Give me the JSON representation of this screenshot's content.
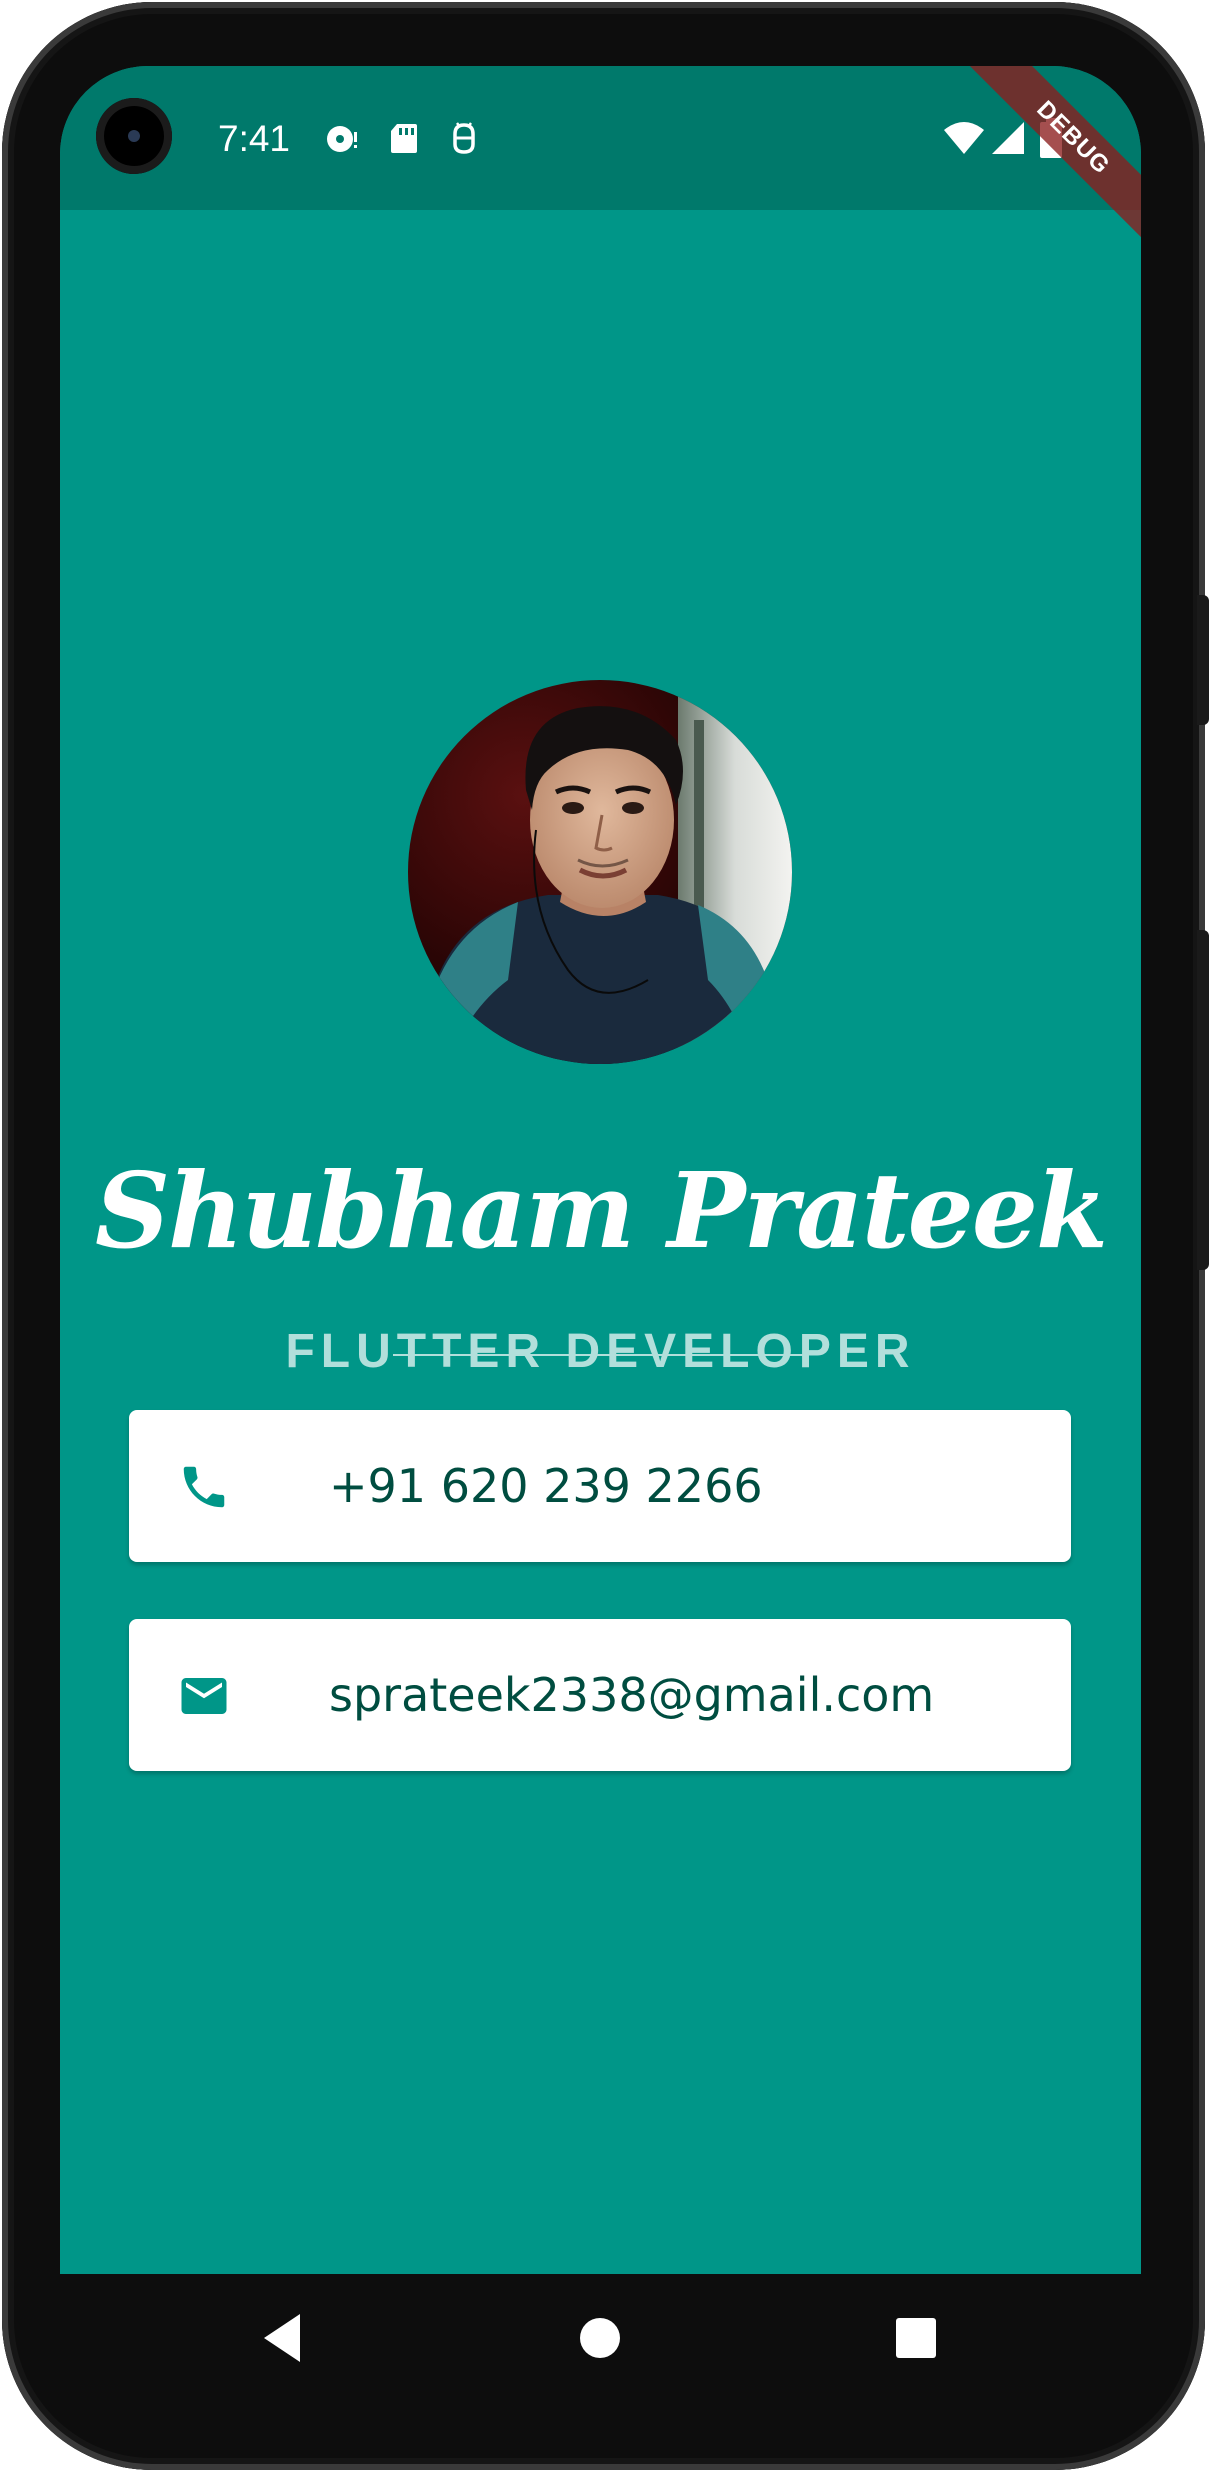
{
  "status_bar": {
    "time": "7:41",
    "icons": [
      "media-disc-icon",
      "sd-card-icon",
      "android-debug-icon",
      "wifi-icon",
      "signal-icon",
      "battery-icon"
    ],
    "debug_label": "DEBUG"
  },
  "profile": {
    "name": "Shubham Prateek",
    "title": "FLUTTER DEVELOPER",
    "avatar_icon": "profile-photo"
  },
  "contacts": [
    {
      "icon": "phone-icon",
      "text": "+91 620 239 2266"
    },
    {
      "icon": "mail-icon",
      "text": "sprateek2338@gmail.com"
    }
  ],
  "nav": {
    "buttons": [
      "back-icon",
      "home-icon",
      "recents-icon"
    ]
  },
  "colors": {
    "background": "#009688",
    "status_bar": "#00796b",
    "subtitle": "#b2dfdb",
    "card_text": "#004d40",
    "icon": "#009688"
  }
}
